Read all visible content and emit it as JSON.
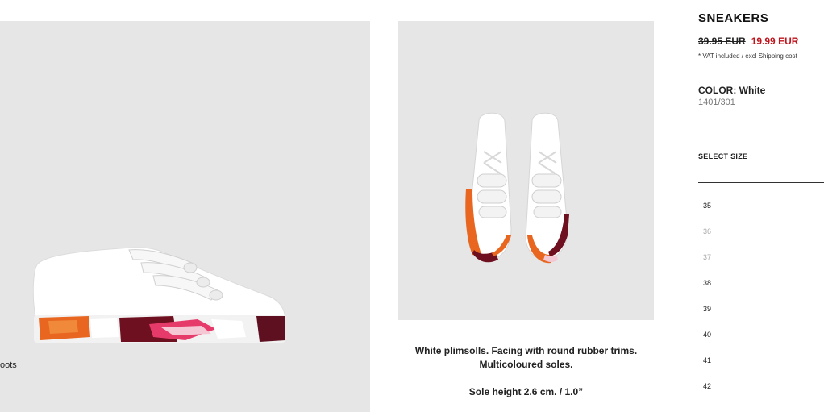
{
  "product": {
    "title": "SNEAKERS",
    "old_price": "39.95 EUR",
    "new_price": "19.99 EUR",
    "vat_note": "* VAT included / excl Shipping cost",
    "color_label": "COLOR: White",
    "reference": "1401/301",
    "select_size_label": "SELECT SIZE",
    "sizes": [
      {
        "label": "35",
        "available": true
      },
      {
        "label": "36",
        "available": false
      },
      {
        "label": "37",
        "available": false
      },
      {
        "label": "38",
        "available": true
      },
      {
        "label": "39",
        "available": true
      },
      {
        "label": "40",
        "available": true
      },
      {
        "label": "41",
        "available": true
      },
      {
        "label": "42",
        "available": true
      }
    ]
  },
  "description": {
    "line1": "White plimsolls. Facing with round rubber trims.",
    "line2": "Multicoloured soles.",
    "line3": "Sole height 2.6 cm. / 1.0”"
  },
  "side_text": "oots",
  "colors": {
    "sale_red": "#c0141c",
    "image_bg": "#e6e6e6"
  }
}
